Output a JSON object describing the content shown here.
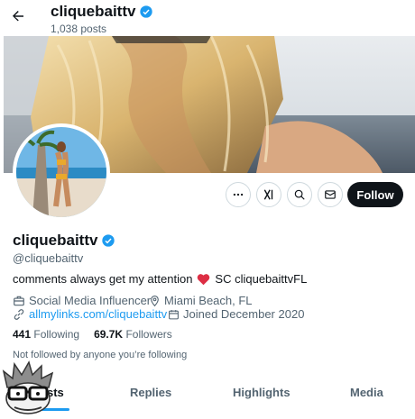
{
  "header": {
    "name": "cliquebaittv",
    "posts": "1,038 posts"
  },
  "profile": {
    "name": "cliquebaittv",
    "handle": "@cliquebaittv",
    "bio_before": "comments always get my attention",
    "bio_after": "SC cliquebaittvFL",
    "category": "Social Media Influencer",
    "location": "Miami Beach, FL",
    "link": "allmylinks.com/cliquebaittv",
    "joined": "Joined December 2020",
    "following_count": "441",
    "following_label": "Following",
    "followers_count": "69.7K",
    "followers_label": "Followers",
    "not_followed": "Not followed by anyone you’re following"
  },
  "actions": {
    "follow_label": "Follow"
  },
  "tabs": [
    {
      "label": "Posts",
      "visible": "sts"
    },
    {
      "label": "Replies"
    },
    {
      "label": "Highlights"
    },
    {
      "label": "Media"
    }
  ],
  "colors": {
    "accent": "#1d9bf0",
    "text": "#0f1419",
    "muted": "#536471",
    "heart": "#f91880"
  },
  "icons": [
    "back-arrow-icon",
    "verified-badge-icon",
    "more-icon",
    "grok-icon",
    "search-icon",
    "message-icon",
    "briefcase-icon",
    "location-icon",
    "link-icon",
    "calendar-icon",
    "heart-emoji-icon"
  ]
}
